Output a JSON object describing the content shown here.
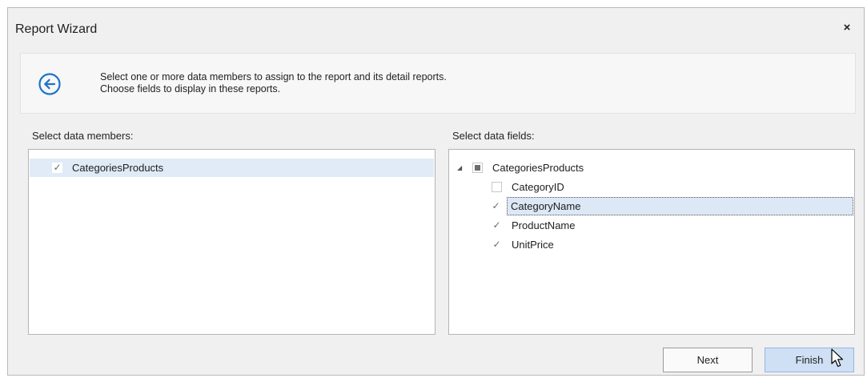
{
  "window": {
    "title": "Report Wizard",
    "close_glyph": "×"
  },
  "header": {
    "back_icon": "back-arrow-circle-icon",
    "line1": "Select one or more data members to assign to the report and its detail reports.",
    "line2": "Choose fields to display in these reports."
  },
  "data_members": {
    "label": "Select data members:",
    "items": [
      {
        "label": "CategoriesProducts",
        "checked": true,
        "selected": true
      }
    ]
  },
  "data_fields": {
    "label": "Select data fields:",
    "root": {
      "label": "CategoriesProducts",
      "expanded": true,
      "state": "indeterminate"
    },
    "items": [
      {
        "label": "CategoryID",
        "checked": false
      },
      {
        "label": "CategoryName",
        "checked": true,
        "focused": true
      },
      {
        "label": "ProductName",
        "checked": true
      },
      {
        "label": "UnitPrice",
        "checked": true
      }
    ]
  },
  "buttons": {
    "next": "Next",
    "finish": "Finish"
  },
  "colors": {
    "accent": "#1e73c9",
    "selection": "#e1ebf7",
    "finish_bg": "#cfe0f5"
  }
}
